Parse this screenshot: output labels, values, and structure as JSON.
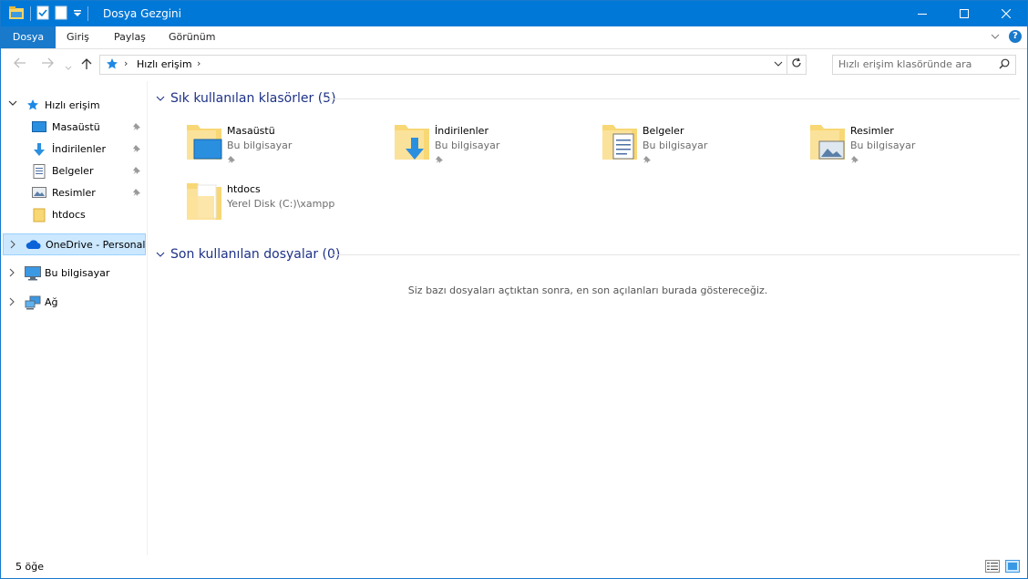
{
  "window": {
    "title": "Dosya Gezgini",
    "accent": "#0078d7"
  },
  "ribbon": {
    "tabs": [
      "Dosya",
      "Giriş",
      "Paylaş",
      "Görünüm"
    ]
  },
  "address": {
    "location": "Hızlı erişim"
  },
  "search": {
    "placeholder": "Hızlı erişim klasöründe ara"
  },
  "nav": {
    "quick_access": "Hızlı erişim",
    "pinned": [
      "Masaüstü",
      "İndirilenler",
      "Belgeler",
      "Resimler"
    ],
    "htdocs": "htdocs",
    "onedrive": "OneDrive - Personal",
    "this_pc": "Bu bilgisayar",
    "network": "Ağ"
  },
  "frequent": {
    "header": "Sık kullanılan klasörler (5)",
    "items": [
      {
        "name": "Masaüstü",
        "location": "Bu bilgisayar",
        "icon": "desktop-folder-icon"
      },
      {
        "name": "İndirilenler",
        "location": "Bu bilgisayar",
        "icon": "downloads-folder-icon"
      },
      {
        "name": "Belgeler",
        "location": "Bu bilgisayar",
        "icon": "documents-folder-icon"
      },
      {
        "name": "Resimler",
        "location": "Bu bilgisayar",
        "icon": "pictures-folder-icon"
      },
      {
        "name": "htdocs",
        "location": "Yerel Disk (C:)\\xampp",
        "icon": "folder-icon"
      }
    ]
  },
  "recent": {
    "header": "Son kullanılan dosyalar (0)",
    "empty_message": "Siz bazı dosyaları açtıktan sonra, en son açılanları burada göstereceğiz."
  },
  "status": {
    "item_count": "5 öğe"
  }
}
